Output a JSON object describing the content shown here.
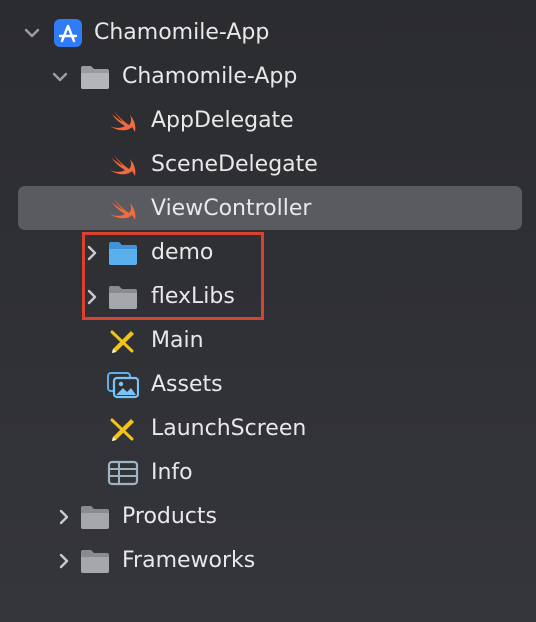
{
  "project": {
    "label": "Chamomile-App",
    "icon": "xcode-project-icon"
  },
  "tree": {
    "group_main": {
      "label": "Chamomile-App",
      "icon": "folder-icon"
    },
    "files": [
      {
        "label": "AppDelegate",
        "icon": "swift-icon"
      },
      {
        "label": "SceneDelegate",
        "icon": "swift-icon"
      },
      {
        "label": "ViewController",
        "icon": "swift-icon",
        "selected": true
      }
    ],
    "highlighted_folders": [
      {
        "label": "demo",
        "icon": "folder-icon",
        "color": "#5ab0ec"
      },
      {
        "label": "flexLibs",
        "icon": "folder-icon",
        "color": "#9a9ba0"
      }
    ],
    "resources": [
      {
        "label": "Main",
        "icon": "storyboard-icon"
      },
      {
        "label": "Assets",
        "icon": "asset-catalog-icon"
      },
      {
        "label": "LaunchScreen",
        "icon": "storyboard-icon"
      },
      {
        "label": "Info",
        "icon": "plist-table-icon"
      }
    ],
    "top_groups": [
      {
        "label": "Products",
        "icon": "folder-icon"
      },
      {
        "label": "Frameworks",
        "icon": "folder-icon"
      }
    ]
  },
  "colors": {
    "background": "#2f3034",
    "selection": "#5a5b61",
    "highlight_border": "#d8432f",
    "text": "#e8e8ea",
    "swift_orange": "#f26a3d",
    "project_blue": "#2f7cf6",
    "storyboard_yellow": "#f0c419"
  }
}
